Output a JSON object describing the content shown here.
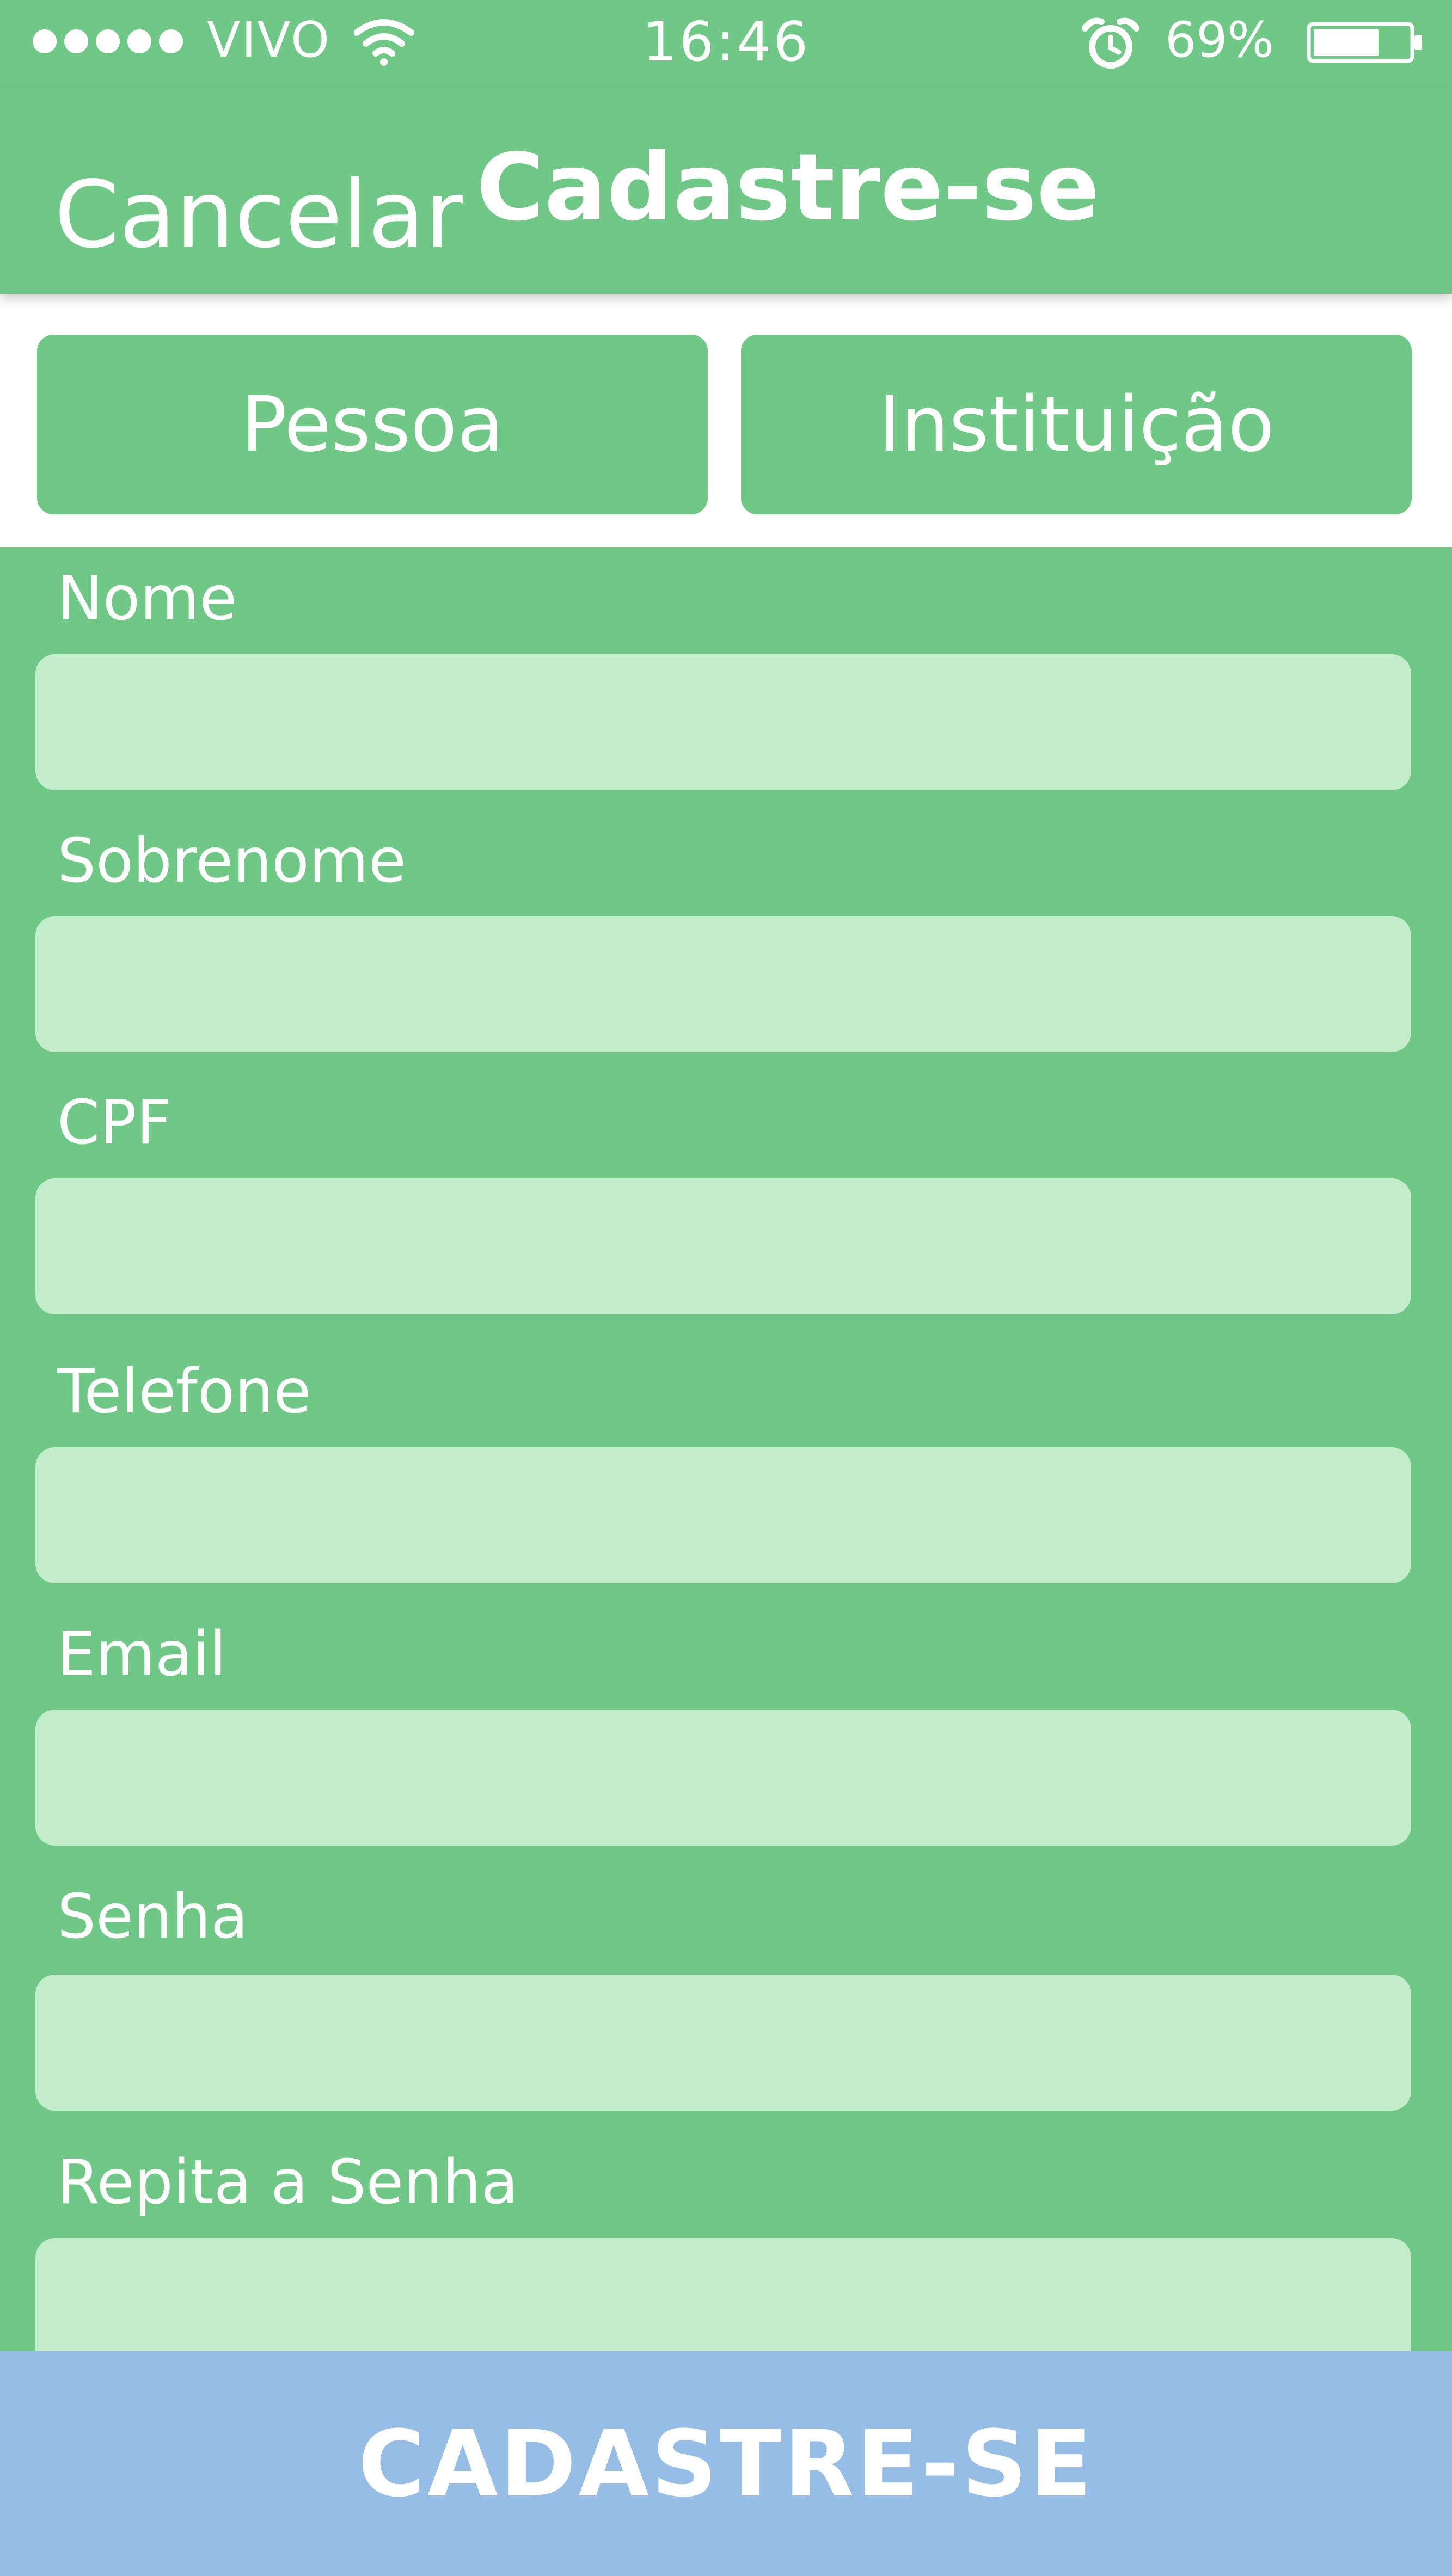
{
  "status_bar": {
    "carrier": "VIVO",
    "time": "16:46",
    "battery_percent": "69%",
    "battery_level": 0.69,
    "icons": [
      "signal-dots",
      "wifi-icon",
      "alarm-icon",
      "battery-icon"
    ]
  },
  "nav": {
    "cancel_label": "Cancelar",
    "title": "Cadastre-se"
  },
  "segments": {
    "pessoa_label": "Pessoa",
    "instituicao_label": "Instituição"
  },
  "form": {
    "fields": [
      {
        "label": "Nome",
        "value": ""
      },
      {
        "label": "Sobrenome",
        "value": ""
      },
      {
        "label": "CPF",
        "value": ""
      },
      {
        "label": "Telefone",
        "value": ""
      },
      {
        "label": "Email",
        "value": ""
      },
      {
        "label": "Senha",
        "value": ""
      },
      {
        "label": "Repita a Senha",
        "value": ""
      }
    ]
  },
  "submit": {
    "label": "CADASTRE-SE"
  },
  "colors": {
    "primary_green": "#70c886",
    "input_fill": "#c3ecca",
    "submit_blue": "#95bde6",
    "text_white": "#ffffff"
  }
}
